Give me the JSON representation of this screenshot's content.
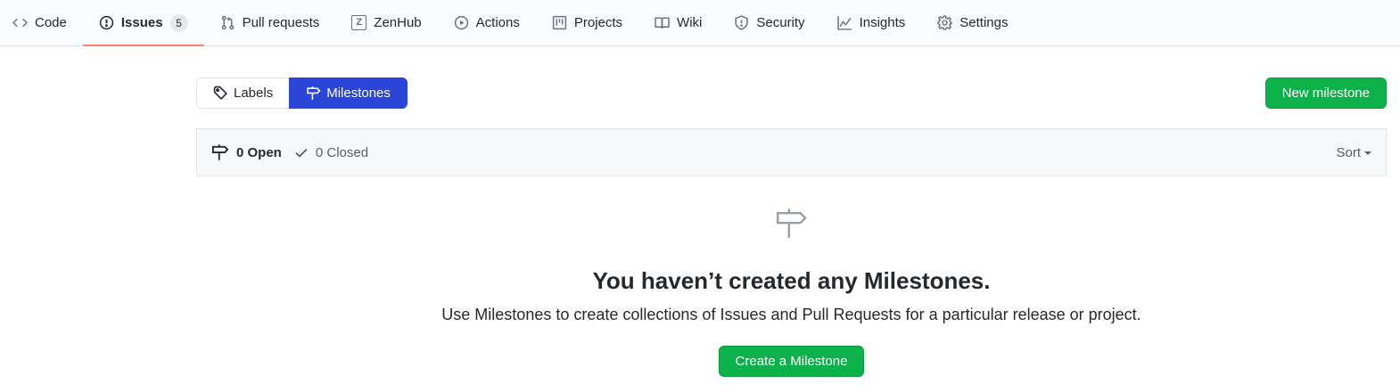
{
  "nav": {
    "tabs": [
      {
        "label": "Code",
        "icon": "code-icon"
      },
      {
        "label": "Issues",
        "icon": "issue-opened-icon",
        "count": "5",
        "selected": true
      },
      {
        "label": "Pull requests",
        "icon": "git-pull-request-icon"
      },
      {
        "label": "ZenHub",
        "icon": "zenhub-icon"
      },
      {
        "label": "Actions",
        "icon": "play-icon"
      },
      {
        "label": "Projects",
        "icon": "project-icon"
      },
      {
        "label": "Wiki",
        "icon": "book-icon"
      },
      {
        "label": "Security",
        "icon": "shield-icon"
      },
      {
        "label": "Insights",
        "icon": "graph-icon"
      },
      {
        "label": "Settings",
        "icon": "gear-icon"
      }
    ]
  },
  "subnav": {
    "labels": "Labels",
    "milestones": "Milestones"
  },
  "toolbar": {
    "new_milestone": "New milestone"
  },
  "states": {
    "open": "0 Open",
    "closed": "0 Closed"
  },
  "sort": {
    "label": "Sort"
  },
  "blankslate": {
    "title": "You haven’t created any Milestones.",
    "description": "Use Milestones to create collections of Issues and Pull Requests for a particular release or project.",
    "button": "Create a Milestone"
  },
  "colors": {
    "accent_blue": "#2b45d9",
    "primary_green": "#0db14a",
    "selected_underline": "#f9826c"
  }
}
